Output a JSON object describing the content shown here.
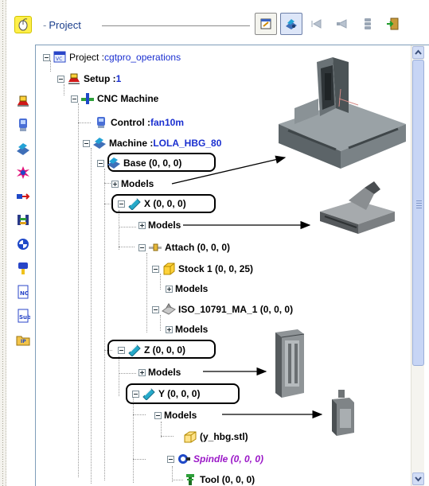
{
  "header": {
    "title": "Project",
    "toolbar_icons": [
      "properties-icon",
      "machine-view-icon",
      "step-back-icon",
      "step-forward-icon",
      "stack-icon",
      "exit-icon"
    ]
  },
  "side_toolbar": {
    "icons": [
      "setup-icon",
      "control-icon",
      "machine-icon",
      "collision-icon",
      "attach-icon",
      "kinematics-icon",
      "sphere-icon",
      "tool-icon",
      "nc-program-icon",
      "subroutine-icon",
      "open-project-icon"
    ]
  },
  "tree": {
    "project": {
      "label": "Project : ",
      "value": "cgtpro_operations"
    },
    "setup": {
      "label": "Setup : ",
      "value": "1"
    },
    "cnc_machine": {
      "label": "CNC Machine"
    },
    "control": {
      "label": "Control : ",
      "value": "fan10m"
    },
    "machine": {
      "label": "Machine : ",
      "value": "LOLA_HBG_80"
    },
    "base": {
      "label": "Base (0, 0, 0)"
    },
    "base_models": {
      "label": "Models"
    },
    "x": {
      "label": "X (0, 0, 0)"
    },
    "x_models": {
      "label": "Models"
    },
    "attach": {
      "label": "Attach (0, 0, 0)"
    },
    "stock": {
      "label": "Stock 1 (0, 0, 25)"
    },
    "stock_models": {
      "label": "Models"
    },
    "iso": {
      "label": "ISO_10791_MA_1 (0, 0, 0)"
    },
    "iso_models": {
      "label": "Models"
    },
    "z": {
      "label": "Z (0, 0, 0)"
    },
    "z_models": {
      "label": "Models"
    },
    "y": {
      "label": "Y (0, 0, 0)"
    },
    "y_models": {
      "label": "Models"
    },
    "y_stl": {
      "label": "(y_hbg.stl)"
    },
    "spindle": {
      "label": "Spindle (0, 0, 0)"
    },
    "tool": {
      "label": "Tool (0, 0, 0)"
    }
  },
  "colors": {
    "value_blue": "#1a2fd0",
    "spindle_purple": "#9b18c8",
    "header_title": "#1b3f8c"
  }
}
